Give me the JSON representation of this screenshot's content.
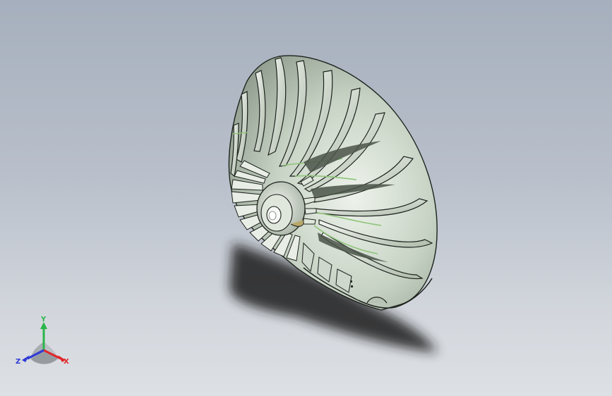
{
  "viewport": {
    "background_top": "#a6afbd",
    "background_bottom": "#dde0e4"
  },
  "model": {
    "type": "impeller",
    "body_color": "#c9d4c6",
    "blade_color": "#e4ebe2",
    "edge_color": "#1d221d",
    "accent_green": "#8fc47a",
    "hub_color": "#d3dbcf"
  },
  "triad": {
    "x_label": "X",
    "y_label": "Y",
    "z_label": "Z",
    "x_color": "#e0262a",
    "y_color": "#2bb54a",
    "z_color": "#2f3ad6"
  }
}
